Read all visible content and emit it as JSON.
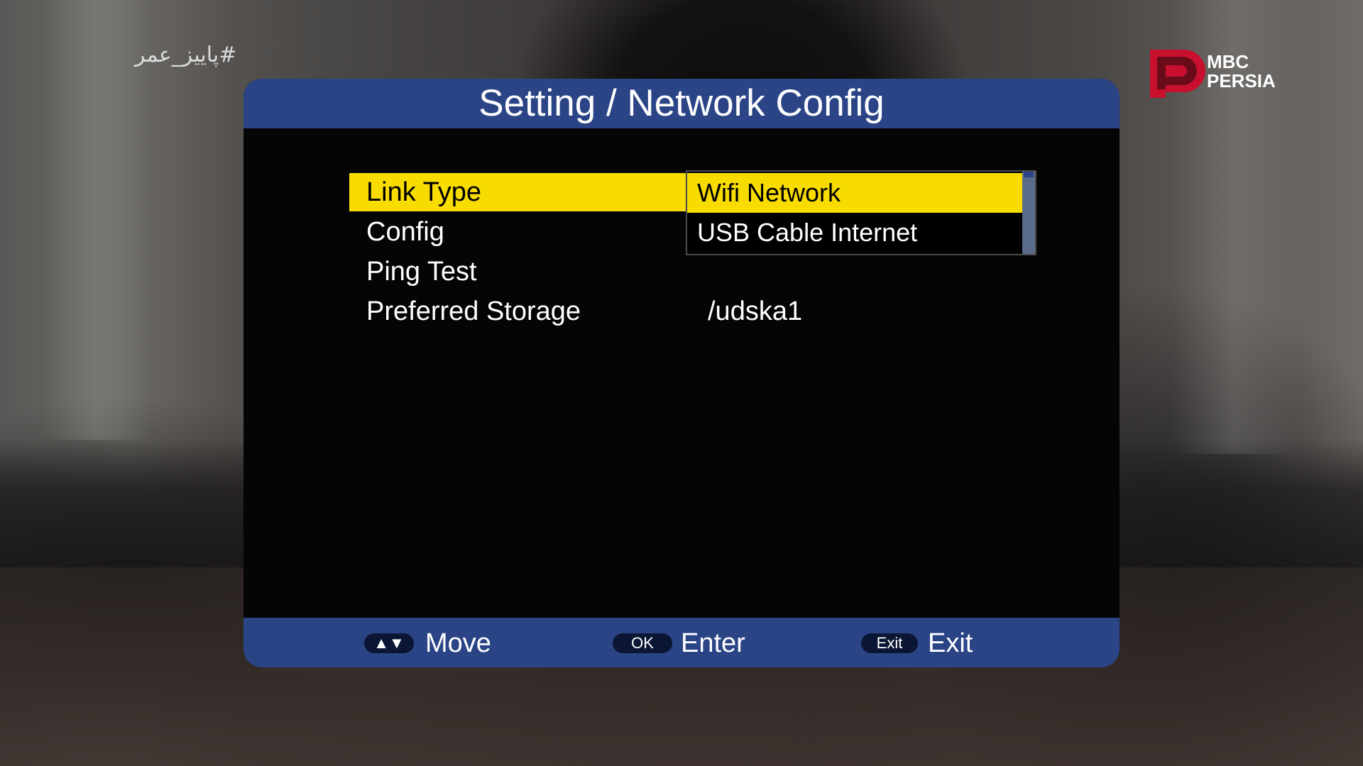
{
  "overlay": {
    "hashtag": "#پاییز_عمر",
    "channel_logo": {
      "line1": "MBC",
      "line2": "PERSIA",
      "color": "#c8102e"
    }
  },
  "dialog": {
    "title": "Setting / Network Config",
    "header_color": "#2a4486",
    "highlight_color": "#f8dc00"
  },
  "menu": {
    "items": [
      {
        "label": "Link Type",
        "value": "Wifi Network",
        "selected": true
      },
      {
        "label": "Config",
        "value": ""
      },
      {
        "label": "Ping Test",
        "value": ""
      },
      {
        "label": "Preferred Storage",
        "value": "/udska1"
      }
    ]
  },
  "dropdown": {
    "options": [
      {
        "label": "Wifi Network",
        "highlighted": true
      },
      {
        "label": "USB Cable Internet",
        "highlighted": false
      }
    ]
  },
  "footer": {
    "hints": [
      {
        "key": "▲▼",
        "label": "Move",
        "icon": "up-down-arrows-icon"
      },
      {
        "key": "OK",
        "label": "Enter"
      },
      {
        "key": "Exit",
        "label": "Exit"
      }
    ]
  }
}
